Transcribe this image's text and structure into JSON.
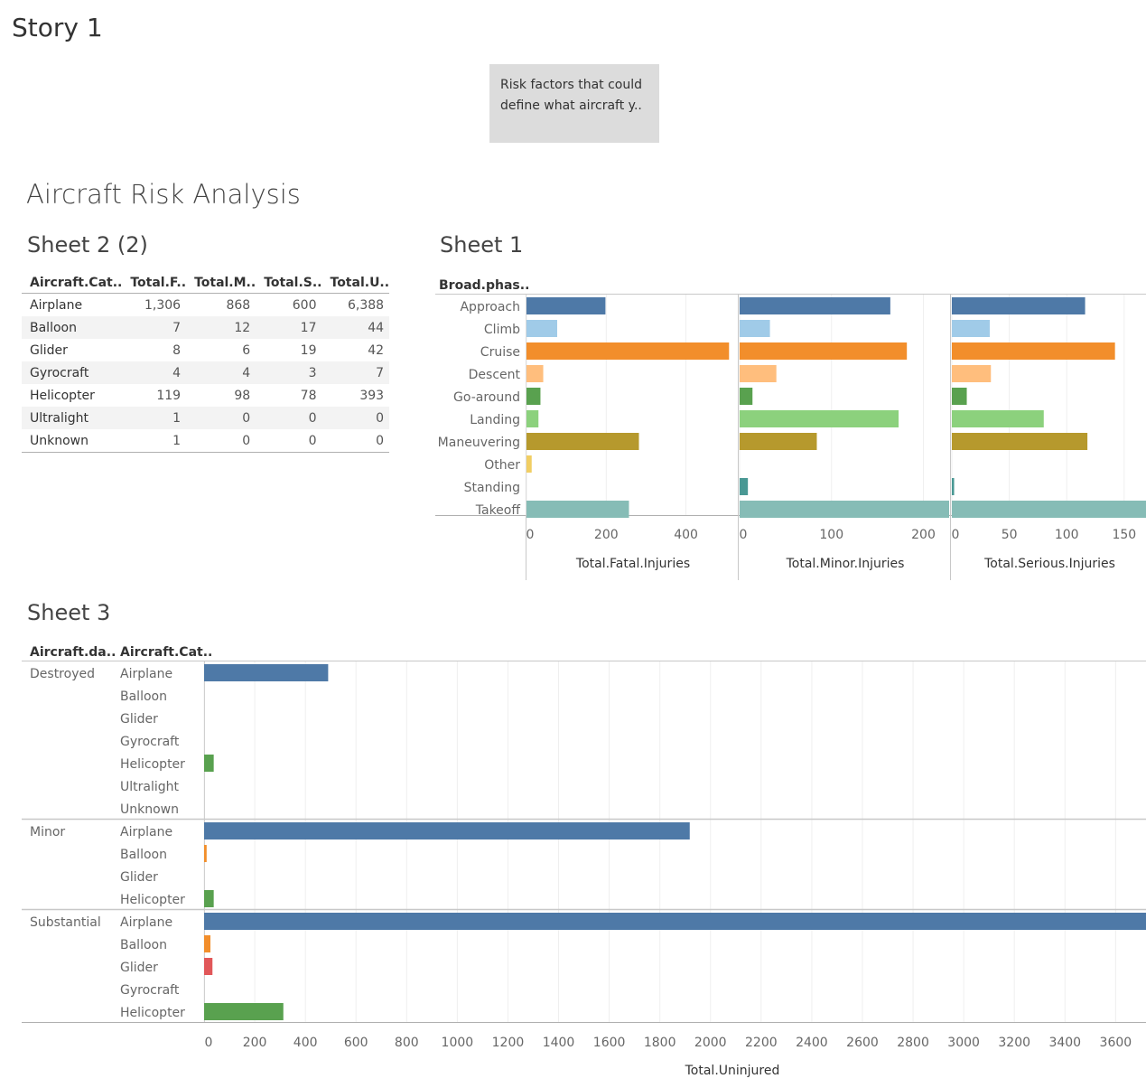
{
  "story": {
    "title": "Story 1",
    "caption": "Risk factors that could define what aircraft y.."
  },
  "dashboard": {
    "title": "Aircraft Risk Analysis"
  },
  "sheet2": {
    "title": "Sheet 2 (2)",
    "columns": [
      "Aircraft.Cat..",
      "Total.F..",
      "Total.M..",
      "Total.S..",
      "Total.U.."
    ],
    "rows": [
      [
        "Airplane",
        "1,306",
        "868",
        "600",
        "6,388"
      ],
      [
        "Balloon",
        "7",
        "12",
        "17",
        "44"
      ],
      [
        "Glider",
        "8",
        "6",
        "19",
        "42"
      ],
      [
        "Gyrocraft",
        "4",
        "4",
        "3",
        "7"
      ],
      [
        "Helicopter",
        "119",
        "98",
        "78",
        "393"
      ],
      [
        "Ultralight",
        "1",
        "0",
        "0",
        "0"
      ],
      [
        "Unknown",
        "1",
        "0",
        "0",
        "0"
      ]
    ]
  },
  "chart_data": [
    {
      "type": "bar",
      "title": "Sheet 1",
      "orientation": "horizontal",
      "row_header": "Broad.phas..",
      "categories": [
        "Approach",
        "Climb",
        "Cruise",
        "Descent",
        "Go-around",
        "Landing",
        "Maneuvering",
        "Other",
        "Standing",
        "Takeoff"
      ],
      "colors": [
        "#4e79a7",
        "#a0cbe8",
        "#f28e2b",
        "#ffbe7d",
        "#59a14f",
        "#8cd17d",
        "#b6992d",
        "#f1ce63",
        "#499894",
        "#86bcb6"
      ],
      "series": [
        {
          "name": "Total.Fatal.Injuries",
          "values": [
            198,
            77,
            508,
            42,
            35,
            30,
            282,
            13,
            0,
            257
          ],
          "ticks": [
            0,
            200,
            400
          ],
          "xlim": [
            0,
            530
          ]
        },
        {
          "name": "Total.Minor.Injuries",
          "values": [
            164,
            33,
            182,
            40,
            14,
            173,
            84,
            0,
            9,
            228
          ],
          "ticks": [
            0,
            100,
            200
          ],
          "xlim": [
            0,
            228
          ]
        },
        {
          "name": "Total.Serious.Injuries",
          "values": [
            116,
            33,
            142,
            34,
            13,
            80,
            118,
            0,
            2,
            169
          ],
          "ticks": [
            0,
            50,
            100,
            150
          ],
          "xlim": [
            0,
            169
          ]
        }
      ]
    },
    {
      "type": "bar",
      "title": "Sheet 3",
      "orientation": "horizontal",
      "column_headers": [
        "Aircraft.da..",
        "Aircraft.Cat.."
      ],
      "xlabel": "Total.Uninjured",
      "xlim": [
        0,
        3720
      ],
      "ticks": [
        0,
        200,
        400,
        600,
        800,
        1000,
        1200,
        1400,
        1600,
        1800,
        2000,
        2200,
        2400,
        2600,
        2800,
        3000,
        3200,
        3400,
        3600
      ],
      "category_colors": {
        "Airplane": "#4e79a7",
        "Balloon": "#f28e2b",
        "Glider": "#e15759",
        "Gyrocraft": "#76b7b2",
        "Helicopter": "#59a14f",
        "Ultralight": "#edc948",
        "Unknown": "#b07aa1"
      },
      "groups": [
        {
          "name": "Destroyed",
          "items": [
            {
              "category": "Airplane",
              "value": 490
            },
            {
              "category": "Balloon",
              "value": 0
            },
            {
              "category": "Glider",
              "value": 0
            },
            {
              "category": "Gyrocraft",
              "value": 0
            },
            {
              "category": "Helicopter",
              "value": 38
            },
            {
              "category": "Ultralight",
              "value": 0
            },
            {
              "category": "Unknown",
              "value": 0
            }
          ]
        },
        {
          "name": "Minor",
          "items": [
            {
              "category": "Airplane",
              "value": 1918
            },
            {
              "category": "Balloon",
              "value": 10
            },
            {
              "category": "Glider",
              "value": 0
            },
            {
              "category": "Helicopter",
              "value": 38
            }
          ]
        },
        {
          "name": "Substantial",
          "items": [
            {
              "category": "Airplane",
              "value": 3720
            },
            {
              "category": "Balloon",
              "value": 25
            },
            {
              "category": "Glider",
              "value": 33
            },
            {
              "category": "Gyrocraft",
              "value": 0
            },
            {
              "category": "Helicopter",
              "value": 313
            }
          ]
        }
      ]
    }
  ]
}
